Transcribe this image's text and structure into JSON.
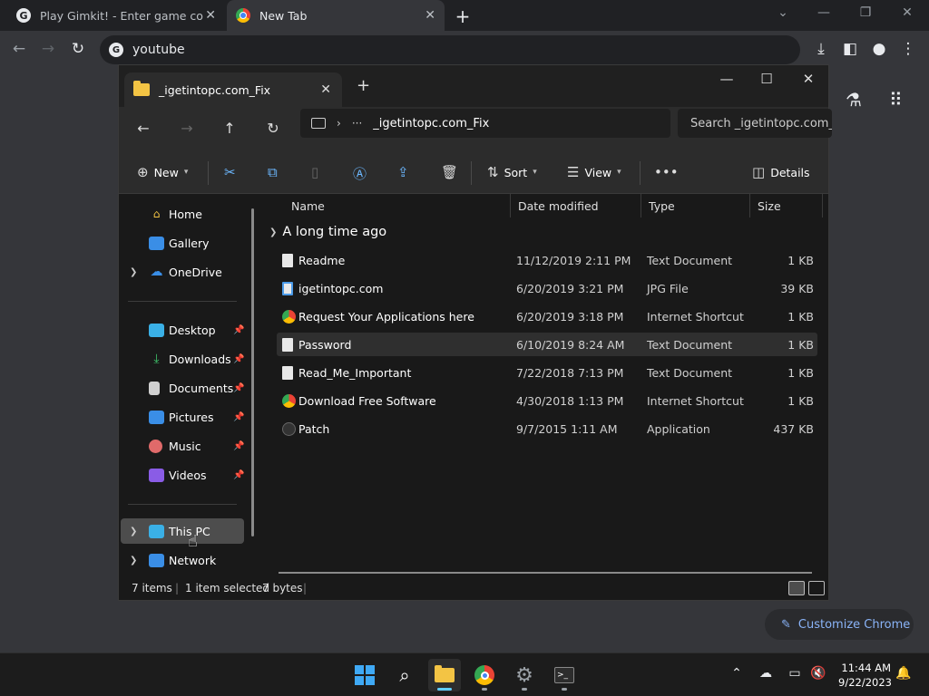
{
  "chrome": {
    "tabs": [
      {
        "title": "Play Gimkit! - Enter game code h"
      },
      {
        "title": "New Tab"
      }
    ],
    "address": "youtube",
    "customize_label": "Customize Chrome"
  },
  "explorer": {
    "tab_title": "_igetintopc.com_Fix",
    "breadcrumb": "_igetintopc.com_Fix",
    "search_placeholder": "Search _igetintopc.com_F",
    "commands": {
      "new": "New",
      "sort": "Sort",
      "view": "View",
      "details": "Details"
    },
    "nav_pane": [
      {
        "label": "Home",
        "icon": "home-icon",
        "pinned": false,
        "expandable": false
      },
      {
        "label": "Gallery",
        "icon": "gallery-icon",
        "pinned": false,
        "expandable": false
      },
      {
        "label": "OneDrive",
        "icon": "cloud-icon",
        "pinned": false,
        "expandable": true
      },
      {
        "label": "Desktop",
        "icon": "desktop-icon",
        "pinned": true,
        "expandable": false
      },
      {
        "label": "Downloads",
        "icon": "download-icon",
        "pinned": true,
        "expandable": false
      },
      {
        "label": "Documents",
        "icon": "documents-icon",
        "pinned": true,
        "expandable": false
      },
      {
        "label": "Pictures",
        "icon": "pictures-icon",
        "pinned": true,
        "expandable": false
      },
      {
        "label": "Music",
        "icon": "music-icon",
        "pinned": true,
        "expandable": false
      },
      {
        "label": "Videos",
        "icon": "videos-icon",
        "pinned": true,
        "expandable": false
      },
      {
        "label": "This PC",
        "icon": "pc-icon",
        "pinned": false,
        "expandable": true
      },
      {
        "label": "Network",
        "icon": "network-icon",
        "pinned": false,
        "expandable": true
      }
    ],
    "columns": [
      "Name",
      "Date modified",
      "Type",
      "Size"
    ],
    "group_label": "A long time ago",
    "files": [
      {
        "name": "Readme",
        "date": "11/12/2019 2:11 PM",
        "type": "Text Document",
        "size": "1 KB",
        "icon": "doc"
      },
      {
        "name": "igetintopc.com",
        "date": "6/20/2019 3:21 PM",
        "type": "JPG File",
        "size": "39 KB",
        "icon": "jpg"
      },
      {
        "name": "Request Your Applications here",
        "date": "6/20/2019 3:18 PM",
        "type": "Internet Shortcut",
        "size": "1 KB",
        "icon": "web"
      },
      {
        "name": "Password",
        "date": "6/10/2019 8:24 AM",
        "type": "Text Document",
        "size": "1 KB",
        "icon": "doc"
      },
      {
        "name": "Read_Me_Important",
        "date": "7/22/2018 7:13 PM",
        "type": "Text Document",
        "size": "1 KB",
        "icon": "doc"
      },
      {
        "name": "Download Free Software",
        "date": "4/30/2018 1:13 PM",
        "type": "Internet Shortcut",
        "size": "1 KB",
        "icon": "web"
      },
      {
        "name": "Patch",
        "date": "9/7/2015 1:11 AM",
        "type": "Application",
        "size": "437 KB",
        "icon": "app"
      }
    ],
    "status": {
      "items": "7 items",
      "selected": "1 item selected",
      "size": "7 bytes"
    }
  },
  "taskbar": {
    "time": "11:44 AM",
    "date": "9/22/2023"
  }
}
